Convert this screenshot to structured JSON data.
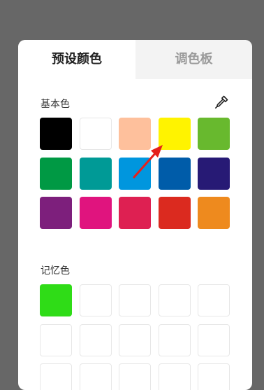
{
  "tabs": {
    "preset_label": "预设颜色",
    "palette_label": "调色板"
  },
  "basic": {
    "label": "基本色",
    "picker_icon": "eyedropper-icon",
    "colors": [
      "#000000",
      "#ffffff",
      "#fec09c",
      "#fff300",
      "#68b92e",
      "#009944",
      "#009a96",
      "#0096de",
      "#005ca9",
      "#271a75",
      "#7d1f7c",
      "#e0147e",
      "#de2052",
      "#db2a1f",
      "#ee8a1e"
    ]
  },
  "memory": {
    "label": "记忆色",
    "colors": [
      "#2fdc17",
      "",
      "",
      "",
      "",
      "",
      "",
      "",
      "",
      "",
      "",
      "",
      "",
      "",
      ""
    ]
  },
  "annotation": {
    "arrow_color": "#e5201a"
  }
}
